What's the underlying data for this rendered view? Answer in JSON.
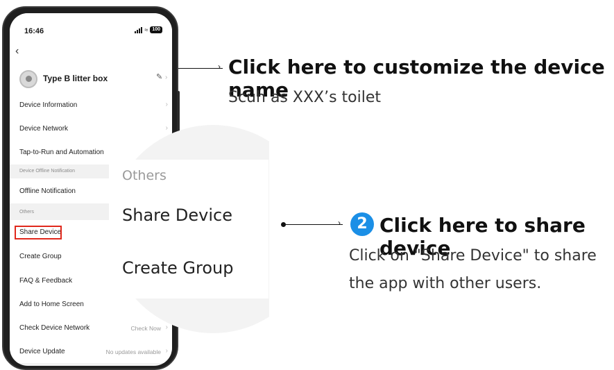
{
  "status_bar": {
    "time": "16:46",
    "battery": "100"
  },
  "device": {
    "name": "Type B litter box"
  },
  "menu": {
    "device_information": "Device Information",
    "device_network": "Device Network",
    "tap_to_run": "Tap-to-Run and Automation",
    "offline_section": "Device Offline Notification",
    "offline_notification": "Offline Notification",
    "others_section": "Others",
    "share_device": "Share Device",
    "create_group": "Create Group",
    "faq": "FAQ & Feedback",
    "add_home": "Add to Home Screen",
    "check_network": "Check Device Network",
    "check_now": "Check Now",
    "device_update": "Device Update",
    "no_updates": "No updates available"
  },
  "zoom": {
    "others": "Others",
    "share_device": "Share Device",
    "create_group": "Create Group"
  },
  "annotation_1": {
    "title": "Click here to customize the device name",
    "subtitle": "Scuh as XXX’s toilet"
  },
  "annotation_2": {
    "step": "2",
    "title": "Click here to share device",
    "line1": "Click on \"Share Device\" to share",
    "line2": "the app with other users."
  },
  "colors": {
    "accent": "#1b8fe6",
    "highlight": "#e0281c"
  },
  "icons": [
    "back-icon",
    "edit-icon",
    "chevron-right-icon",
    "signal-icon",
    "wifi-icon",
    "battery-icon"
  ]
}
